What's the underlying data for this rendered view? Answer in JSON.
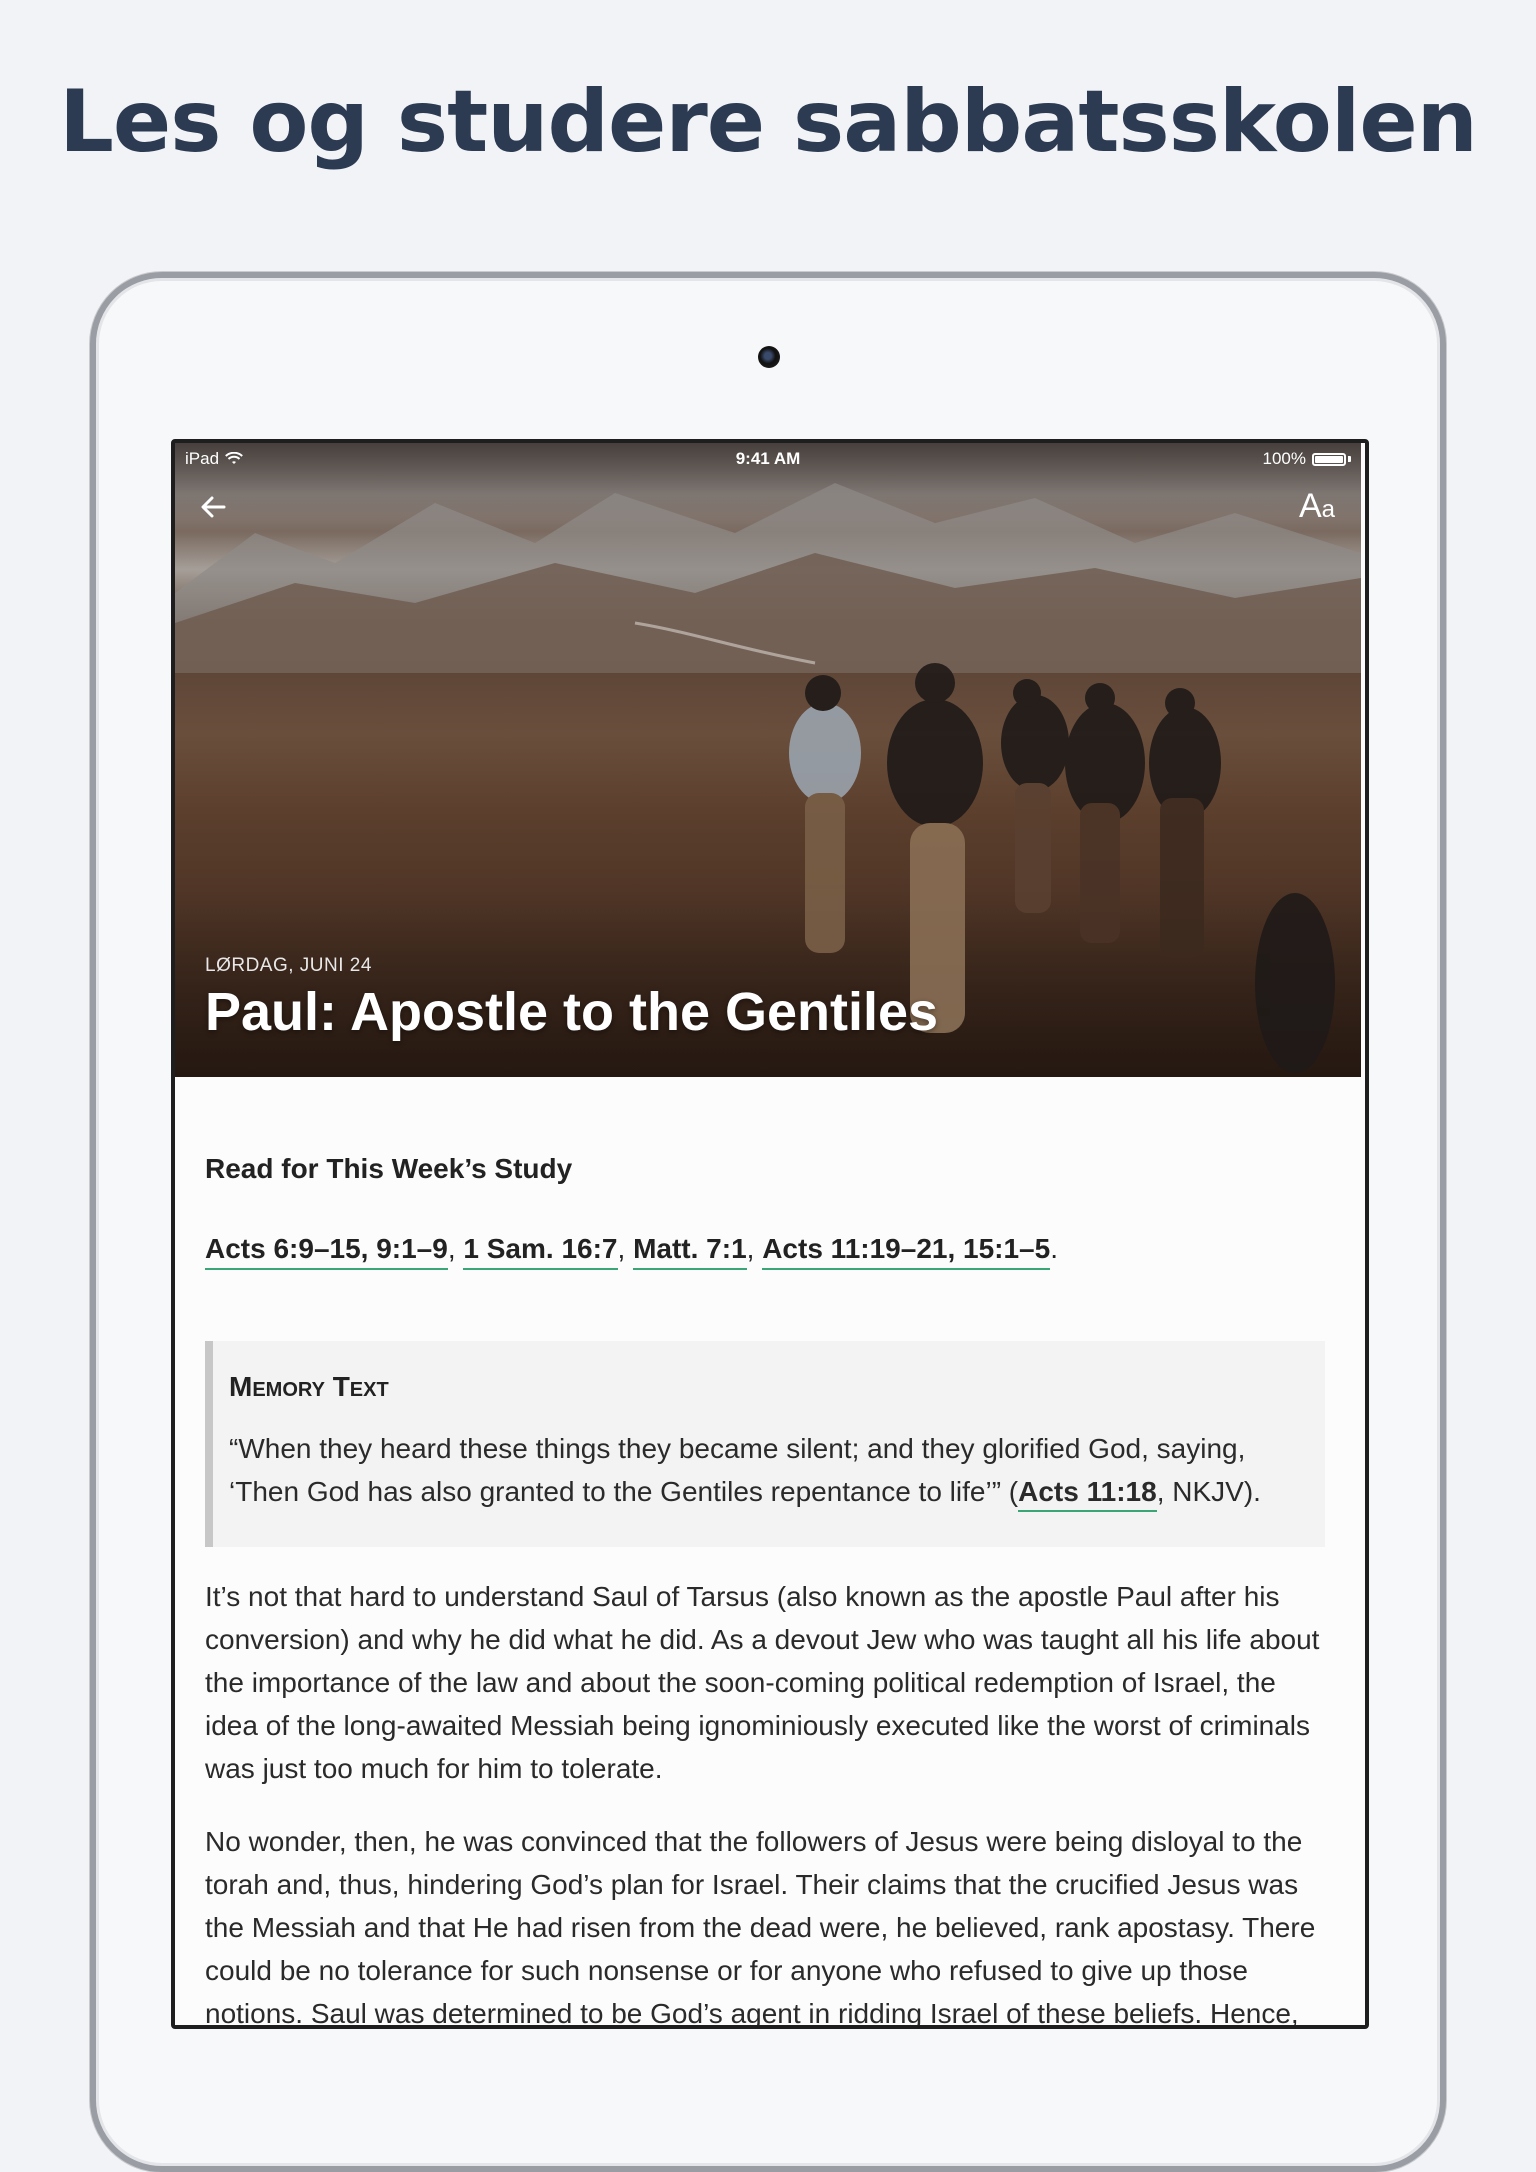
{
  "promo": {
    "title": "Les og studere sabbatsskolen"
  },
  "status_bar": {
    "device": "iPad",
    "time": "9:41 AM",
    "battery": "100%",
    "battery_level": 1.0
  },
  "toolbar": {
    "back_icon": "arrow-left-icon",
    "font_big": "A",
    "font_small": "a"
  },
  "hero": {
    "date": "LØRDAG, JUNI 24",
    "title": "Paul: Apostle to the Gentiles"
  },
  "study": {
    "heading": "Read for This Week’s Study",
    "refs": [
      "Acts 6:9–15, 9:1–9",
      "1 Sam. 16:7",
      "Matt. 7:1",
      "Acts 11:19–21, 15:1–5"
    ],
    "ref_separator": ", ",
    "ref_end": "."
  },
  "memory": {
    "label": "Memory Text",
    "text_before": "“When they heard these things they became silent; and they glorified God, saying, ‘Then God has also granted to the Gentiles repentance to life’” (",
    "ref": "Acts 11:18",
    "text_after": ", NKJV)."
  },
  "paragraphs": [
    "It’s not that hard to understand Saul of Tarsus (also known as the apostle Paul after his conversion) and why he did what he did. As a devout Jew who was taught all his life about the importance of the law and about the soon-coming political redemption of Israel, the idea of the long-awaited Messiah being ignominiously executed like the worst of criminals was just too much for him to tolerate.",
    "No wonder, then, he was convinced that the followers of Jesus were being disloyal to the torah and, thus, hindering God’s plan for Israel. Their claims that the crucified Jesus was the Messiah and that He had risen from the dead were, he believed, rank apostasy. There could be no tolerance for such nonsense or for anyone who refused to give up those notions. Saul was determined to be God’s agent in ridding Israel of these beliefs. Hence, he first appears in the pages of Scripture as a violent persecutor of his fellow"
  ]
}
